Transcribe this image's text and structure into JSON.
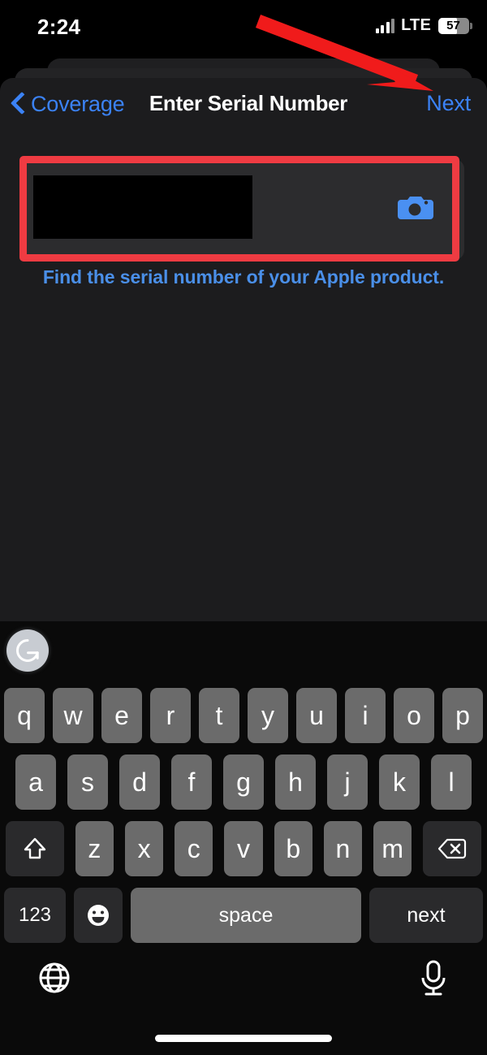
{
  "status_bar": {
    "time": "2:24",
    "network_label": "LTE",
    "battery_percent": "57",
    "signal_icon": "cellular-signal-icon",
    "battery_icon": "battery-icon"
  },
  "nav": {
    "back_icon": "chevron-left-icon",
    "back_label": "Coverage",
    "title": "Enter Serial Number",
    "next_label": "Next"
  },
  "form": {
    "serial_input_value": "",
    "serial_input_placeholder": "",
    "camera_icon": "camera-icon",
    "helper_link": "Find the serial number of your Apple product."
  },
  "annotations": {
    "highlight_color": "#ef3b42",
    "arrow_color": "#f01b1b",
    "highlight_target": "serial-number-input",
    "arrow_target": "serial-number-input"
  },
  "keyboard": {
    "assistant_icon": "grammarly-icon",
    "assistant_label": "G",
    "row1": [
      "q",
      "w",
      "e",
      "r",
      "t",
      "y",
      "u",
      "i",
      "o",
      "p"
    ],
    "row2": [
      "a",
      "s",
      "d",
      "f",
      "g",
      "h",
      "j",
      "k",
      "l"
    ],
    "row3": [
      "z",
      "x",
      "c",
      "v",
      "b",
      "n",
      "m"
    ],
    "shift_icon": "shift-icon",
    "backspace_icon": "backspace-icon",
    "numbers_label": "123",
    "emoji_icon": "emoji-icon",
    "space_label": "space",
    "return_label": "next",
    "globe_icon": "globe-icon",
    "mic_icon": "microphone-icon"
  },
  "colors": {
    "accent_blue": "#3b82f6",
    "link_blue": "#4a8fe8",
    "sheet_bg": "#1c1c1e",
    "field_bg": "#2c2c2e",
    "key_bg": "#6b6b6b",
    "key_dark_bg": "#2a2a2c"
  }
}
